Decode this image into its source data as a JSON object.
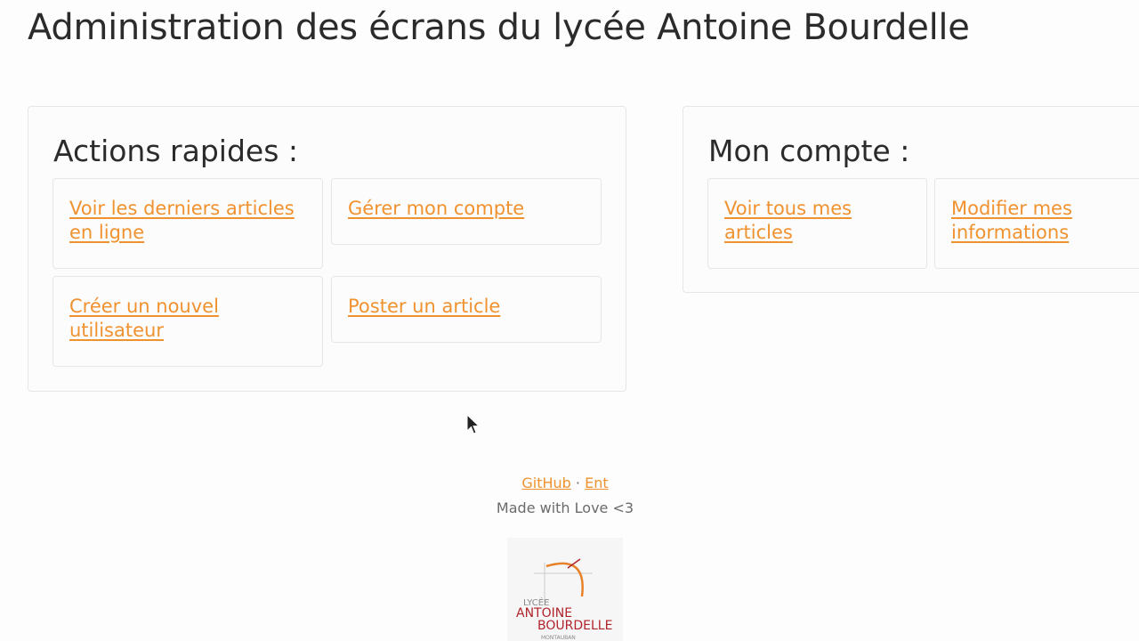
{
  "header": {
    "title": "Administration des écrans du lycée Antoine Bourdelle"
  },
  "quick_actions": {
    "heading": "Actions rapides :",
    "links": [
      {
        "label": "Voir les derniers articles en ligne"
      },
      {
        "label": "Gérer mon compte"
      },
      {
        "label": "Créer un nouvel utilisateur"
      },
      {
        "label": "Poster un article"
      }
    ]
  },
  "account": {
    "heading": "Mon compte :",
    "links": [
      {
        "label": "Voir tous mes articles"
      },
      {
        "label": "Modifier mes informations"
      }
    ]
  },
  "footer": {
    "github_label": "GitHub",
    "separator": "·",
    "ent_label": "Ent",
    "tagline": "Made with Love <3"
  },
  "logo": {
    "line1": "LYCÉE",
    "line2": "ANTOINE",
    "line3": "BOURDELLE",
    "line4": "MONTAUBAN"
  },
  "colors": {
    "link": "#f0922f",
    "logo_red": "#b0232a",
    "logo_orange": "#e8822a"
  }
}
